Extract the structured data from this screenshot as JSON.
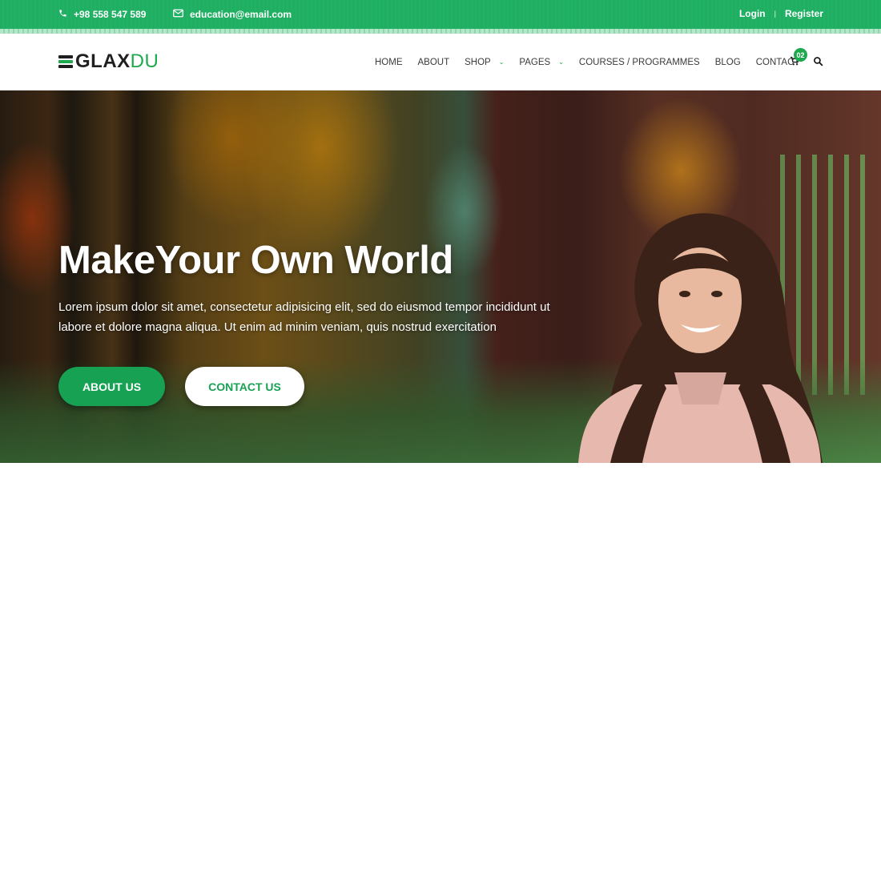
{
  "topbar": {
    "phone": "+98 558 547 589",
    "phone_icon": "phone-icon",
    "email": "education@email.com",
    "email_icon": "envelope-icon",
    "login": "Login",
    "separator": "|",
    "register": "Register"
  },
  "navbar": {
    "logo": {
      "main": "GLAX",
      "accent": "DU"
    },
    "menu": [
      {
        "label": "HOME",
        "dropdown": false
      },
      {
        "label": "ABOUT",
        "dropdown": false
      },
      {
        "label": "SHOP",
        "dropdown": true
      },
      {
        "label": "PAGES",
        "dropdown": true
      },
      {
        "label": "COURSES / PROGRAMMES",
        "dropdown": false
      },
      {
        "label": "BLOG",
        "dropdown": false
      },
      {
        "label": "CONTACT",
        "dropdown": false
      }
    ],
    "cart_icon": "cart-icon",
    "cart_count": "02",
    "search_icon": "search-icon"
  },
  "hero": {
    "title": "MakeYour Own World",
    "text": "Lorem ipsum dolor sit amet, consectetur adipisicing elit, sed do eiusmod tempor incididunt ut labore et dolore magna aliqua. Ut enim ad minim veniam, quis nostrud exercitation",
    "buttons": {
      "about": "ABOUT US",
      "contact": "CONTACT US"
    },
    "image_description": "Smiling student with long wavy hair in a pink shirt, blurred autumn campus background"
  },
  "colors": {
    "brand_green": "#1ea94f",
    "topbar_green": "#20b064",
    "text_dark": "#3a3a3a",
    "white": "#ffffff"
  }
}
